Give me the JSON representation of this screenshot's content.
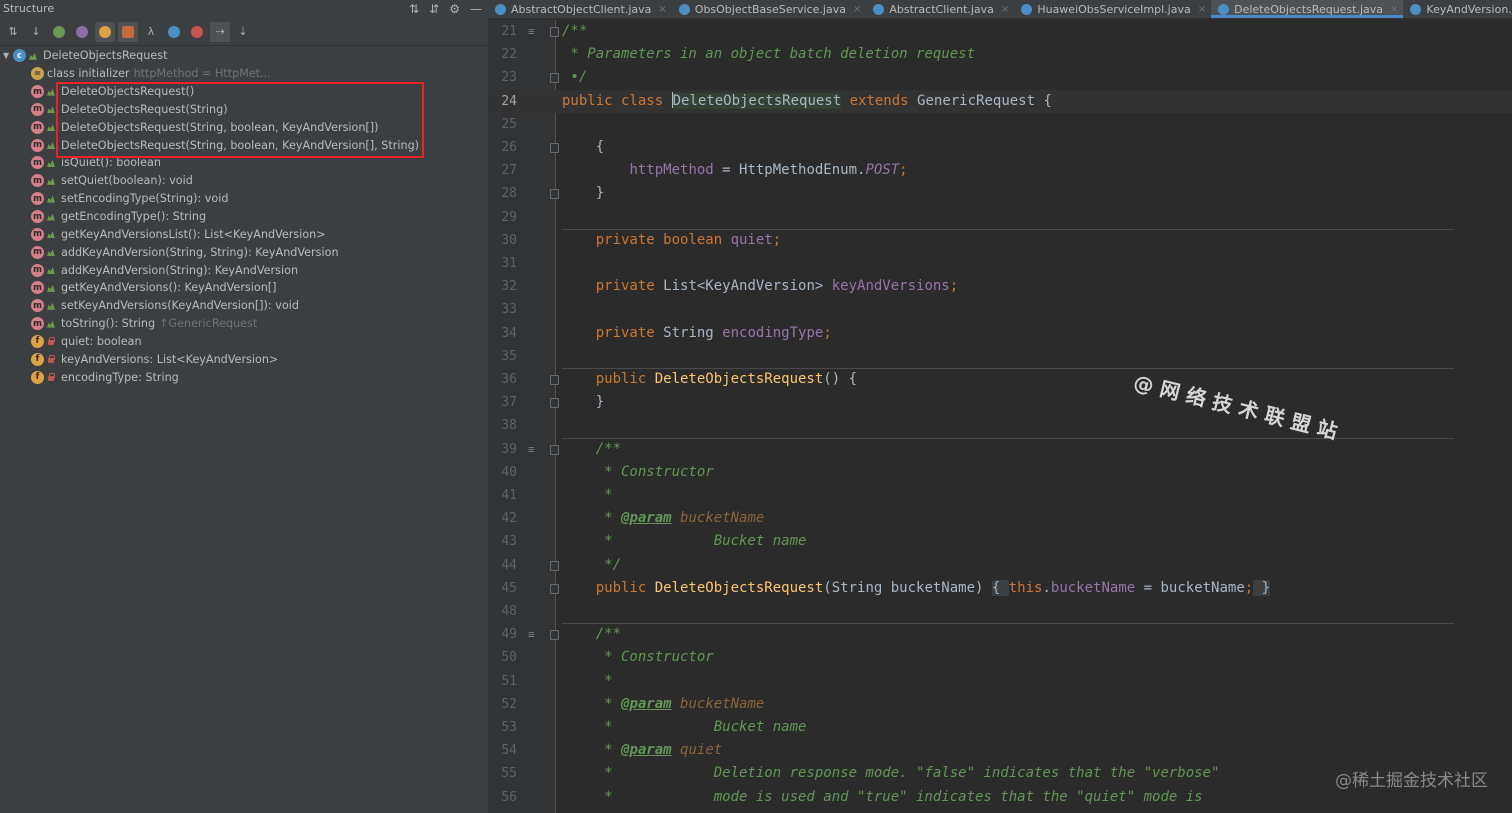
{
  "structure": {
    "title": "Structure",
    "root": "DeleteObjectsRequest",
    "items": [
      {
        "kind": "init",
        "label": "class initializer",
        "hint": "httpMethod = HttpMet...",
        "vis": "none"
      },
      {
        "kind": "m",
        "label": "DeleteObjectsRequest()",
        "hint": "",
        "vis": "pub"
      },
      {
        "kind": "m",
        "label": "DeleteObjectsRequest(String)",
        "hint": "",
        "vis": "pub"
      },
      {
        "kind": "m",
        "label": "DeleteObjectsRequest(String, boolean, KeyAndVersion[])",
        "hint": "",
        "vis": "pub"
      },
      {
        "kind": "m",
        "label": "DeleteObjectsRequest(String, boolean, KeyAndVersion[], String)",
        "hint": "",
        "vis": "pub"
      },
      {
        "kind": "m",
        "label": "isQuiet(): boolean",
        "hint": "",
        "vis": "pub"
      },
      {
        "kind": "m",
        "label": "setQuiet(boolean): void",
        "hint": "",
        "vis": "pub"
      },
      {
        "kind": "m",
        "label": "setEncodingType(String): void",
        "hint": "",
        "vis": "pub"
      },
      {
        "kind": "m",
        "label": "getEncodingType(): String",
        "hint": "",
        "vis": "pub"
      },
      {
        "kind": "m",
        "label": "getKeyAndVersionsList(): List<KeyAndVersion>",
        "hint": "",
        "vis": "pub"
      },
      {
        "kind": "m",
        "label": "addKeyAndVersion(String, String): KeyAndVersion",
        "hint": "",
        "vis": "pub"
      },
      {
        "kind": "m",
        "label": "addKeyAndVersion(String): KeyAndVersion",
        "hint": "",
        "vis": "pub"
      },
      {
        "kind": "m",
        "label": "getKeyAndVersions(): KeyAndVersion[]",
        "hint": "",
        "vis": "pub"
      },
      {
        "kind": "m",
        "label": "setKeyAndVersions(KeyAndVersion[]): void",
        "hint": "",
        "vis": "pub"
      },
      {
        "kind": "m",
        "label": "toString(): String",
        "hint": "↑GenericRequest",
        "vis": "pub"
      },
      {
        "kind": "f",
        "label": "quiet: boolean",
        "hint": "",
        "vis": "priv"
      },
      {
        "kind": "f",
        "label": "keyAndVersions: List<KeyAndVersion>",
        "hint": "",
        "vis": "priv"
      },
      {
        "kind": "f",
        "label": "encodingType: String",
        "hint": "",
        "vis": "priv"
      }
    ]
  },
  "tabs": [
    {
      "label": "AbstractObjectClient.java",
      "active": false
    },
    {
      "label": "ObsObjectBaseService.java",
      "active": false
    },
    {
      "label": "AbstractClient.java",
      "active": false
    },
    {
      "label": "HuaweiObsServiceImpl.java",
      "active": false
    },
    {
      "label": "DeleteObjectsRequest.java",
      "active": true
    },
    {
      "label": "KeyAndVersion.java",
      "active": false
    }
  ],
  "code": {
    "lines": [
      {
        "n": "21",
        "tokens": [
          [
            "cm",
            "/**"
          ]
        ],
        "fold": true,
        "gmark": "≡"
      },
      {
        "n": "22",
        "tokens": [
          [
            "cm",
            " * Parameters in an object batch deletion request"
          ]
        ]
      },
      {
        "n": "23",
        "tokens": [
          [
            "cm",
            " •/"
          ]
        ],
        "fold": true
      },
      {
        "n": "24",
        "tokens": [
          [
            "k",
            "public class "
          ],
          [
            "caret",
            ""
          ],
          [
            "sel",
            "DeleteObjectsRequest"
          ],
          [
            "",
            " "
          ],
          [
            "k",
            "extends "
          ],
          [
            "",
            "GenericRequest {"
          ]
        ],
        "current": true
      },
      {
        "n": "25",
        "tokens": []
      },
      {
        "n": "26",
        "tokens": [
          [
            "",
            "    {"
          ]
        ],
        "fold": true
      },
      {
        "n": "27",
        "tokens": [
          [
            "",
            "        "
          ],
          [
            "fld",
            "httpMethod"
          ],
          [
            "",
            " = HttpMethodEnum."
          ],
          [
            "cst",
            "POST"
          ],
          [
            "k",
            ";"
          ]
        ]
      },
      {
        "n": "28",
        "tokens": [
          [
            "",
            "    }"
          ]
        ],
        "fold": true
      },
      {
        "n": "29",
        "tokens": []
      },
      {
        "n": "30",
        "tokens": [
          [
            "k",
            "    private boolean "
          ],
          [
            "fld",
            "quiet"
          ],
          [
            "k",
            ";"
          ]
        ]
      },
      {
        "n": "31",
        "tokens": []
      },
      {
        "n": "32",
        "tokens": [
          [
            "k",
            "    private "
          ],
          [
            "",
            "List<KeyAndVersion> "
          ],
          [
            "fld",
            "keyAndVersions"
          ],
          [
            "k",
            ";"
          ]
        ]
      },
      {
        "n": "33",
        "tokens": []
      },
      {
        "n": "34",
        "tokens": [
          [
            "k",
            "    private "
          ],
          [
            "",
            "String "
          ],
          [
            "fld",
            "encodingType"
          ],
          [
            "k",
            ";"
          ]
        ]
      },
      {
        "n": "35",
        "tokens": []
      },
      {
        "n": "36",
        "tokens": [
          [
            "k",
            "    public "
          ],
          [
            "fn",
            "DeleteObjectsRequest"
          ],
          [
            "",
            "() {"
          ]
        ],
        "fold": true
      },
      {
        "n": "37",
        "tokens": [
          [
            "",
            "    }"
          ]
        ],
        "fold": true
      },
      {
        "n": "38",
        "tokens": []
      },
      {
        "n": "39",
        "tokens": [
          [
            "cm",
            "    /**"
          ]
        ],
        "fold": true,
        "gmark": "≡"
      },
      {
        "n": "40",
        "tokens": [
          [
            "cm",
            "     * Constructor"
          ]
        ]
      },
      {
        "n": "41",
        "tokens": [
          [
            "cm",
            "     *"
          ]
        ]
      },
      {
        "n": "42",
        "tokens": [
          [
            "cm",
            "     * "
          ],
          [
            "dt",
            "@param"
          ],
          [
            "cm",
            " "
          ],
          [
            "pn",
            "bucketName"
          ]
        ]
      },
      {
        "n": "43",
        "tokens": [
          [
            "cm",
            "     *            Bucket name"
          ]
        ]
      },
      {
        "n": "44",
        "tokens": [
          [
            "cm",
            "     */"
          ]
        ],
        "fold": true
      },
      {
        "n": "45",
        "tokens": [
          [
            "k",
            "    public "
          ],
          [
            "fn",
            "DeleteObjectsRequest"
          ],
          [
            "",
            "(String bucketName) "
          ],
          [
            "fbox",
            "{ "
          ],
          [
            "k",
            "this"
          ],
          [
            "",
            "."
          ],
          [
            "fld",
            "bucketName"
          ],
          [
            "",
            " = bucketName"
          ],
          [
            "k",
            ";"
          ],
          [
            "fbox",
            " }"
          ]
        ],
        "fold": true
      },
      {
        "n": "48",
        "tokens": []
      },
      {
        "n": "49",
        "tokens": [
          [
            "cm",
            "    /**"
          ]
        ],
        "fold": true,
        "gmark": "≡"
      },
      {
        "n": "50",
        "tokens": [
          [
            "cm",
            "     * Constructor"
          ]
        ]
      },
      {
        "n": "51",
        "tokens": [
          [
            "cm",
            "     *"
          ]
        ]
      },
      {
        "n": "52",
        "tokens": [
          [
            "cm",
            "     * "
          ],
          [
            "dt",
            "@param"
          ],
          [
            "cm",
            " "
          ],
          [
            "pn",
            "bucketName"
          ]
        ]
      },
      {
        "n": "53",
        "tokens": [
          [
            "cm",
            "     *            Bucket name"
          ]
        ]
      },
      {
        "n": "54",
        "tokens": [
          [
            "cm",
            "     * "
          ],
          [
            "dt",
            "@param"
          ],
          [
            "cm",
            " "
          ],
          [
            "pn",
            "quiet"
          ]
        ]
      },
      {
        "n": "55",
        "tokens": [
          [
            "cm",
            "     *            Deletion response mode. \"false\" indicates that the \"verbose\""
          ]
        ]
      },
      {
        "n": "56",
        "tokens": [
          [
            "cm",
            "     *            mode is used and \"true\" indicates that the \"quiet\" mode is"
          ]
        ]
      }
    ]
  },
  "watermark": "@网络技术联盟站",
  "corner_watermark": "@稀土掘金技术社区",
  "icons": {
    "method": "m",
    "field": "f",
    "class": "c",
    "initializer": "="
  },
  "colors": {
    "keyword": "#cc7832",
    "comment": "#629755",
    "field": "#9876aa",
    "function": "#ffc66d",
    "highlight_box": "#e8242a",
    "active_tab_underline": "#4a88c7"
  }
}
